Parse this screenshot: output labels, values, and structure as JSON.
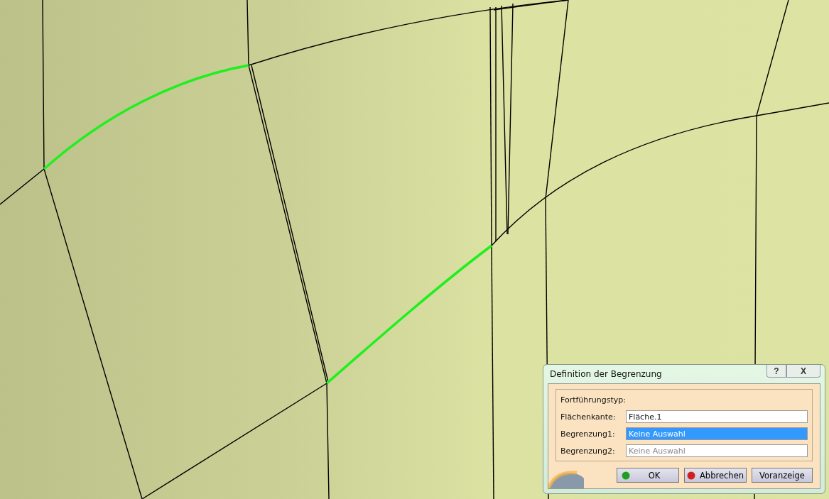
{
  "dialog": {
    "title": "Definition der Begrenzung",
    "help": "?",
    "close": "X",
    "section_label": "Fortführungstyp:",
    "fields": [
      {
        "label": "Flächenkante:",
        "value": "Fläche.1",
        "selected": false
      },
      {
        "label": "Begrenzung1:",
        "value": "Keine Auswahl",
        "selected": true
      },
      {
        "label": "Begrenzung2:",
        "placeholder": "Keine Auswahl",
        "selected": false
      }
    ],
    "buttons": [
      {
        "label": "OK",
        "kind": "ok"
      },
      {
        "label": "Abbrechen",
        "kind": "cancel"
      },
      {
        "label": "Voranzeige",
        "kind": "plain"
      }
    ]
  }
}
